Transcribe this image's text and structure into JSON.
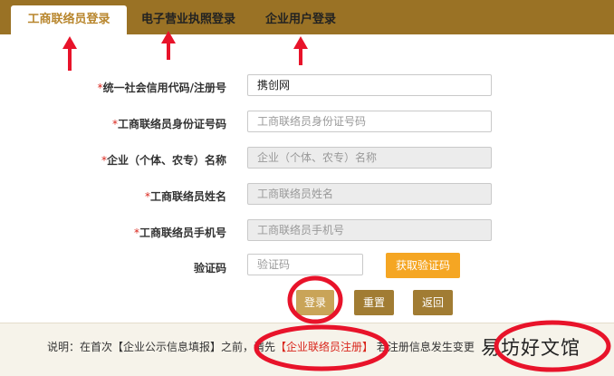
{
  "tabs": [
    {
      "label": "工商联络员登录",
      "active": true
    },
    {
      "label": "电子营业执照登录",
      "active": false
    },
    {
      "label": "企业用户登录",
      "active": false
    }
  ],
  "form": {
    "required_mark": "*",
    "rows": [
      {
        "label": "统一社会信用代码/注册号",
        "required": true,
        "value": "携创网",
        "placeholder": "",
        "disabled": false
      },
      {
        "label": "工商联络员身份证号码",
        "required": true,
        "value": "",
        "placeholder": "工商联络员身份证号码",
        "disabled": false
      },
      {
        "label": "企业（个体、农专）名称",
        "required": true,
        "value": "",
        "placeholder": "企业（个体、农专）名称",
        "disabled": true
      },
      {
        "label": "工商联络员姓名",
        "required": true,
        "value": "",
        "placeholder": "工商联络员姓名",
        "disabled": true
      },
      {
        "label": "工商联络员手机号",
        "required": true,
        "value": "",
        "placeholder": "工商联络员手机号",
        "disabled": true
      },
      {
        "label": "验证码",
        "required": false,
        "value": "",
        "placeholder": "验证码",
        "disabled": false
      }
    ],
    "get_code_label": "获取验证码"
  },
  "buttons": {
    "login": "登录",
    "reset": "重置",
    "back": "返回"
  },
  "footer": {
    "prefix": "说明：在首次【企业公示信息填报】之前，请先",
    "link": "【企业联络员注册】",
    "suffix": "  若注册信息发生变更"
  },
  "watermark": "易坊好文馆",
  "colors": {
    "brand": "#9a7225",
    "accent_button": "#f5a623",
    "annotation": "#e8132a"
  }
}
